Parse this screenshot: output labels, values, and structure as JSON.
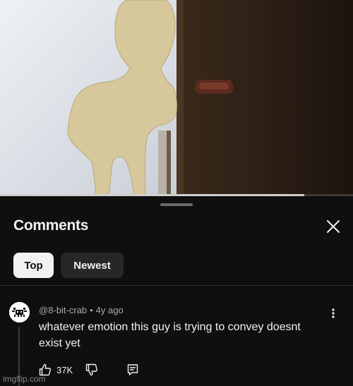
{
  "video": {
    "progress_fraction": 0.862
  },
  "comments_panel": {
    "title": "Comments",
    "close_icon": "close-icon",
    "filters": [
      {
        "label": "Top",
        "selected": true
      },
      {
        "label": "Newest",
        "selected": false
      }
    ]
  },
  "comment": {
    "author": "@8-bit-crab",
    "separator": "•",
    "age": "4y ago",
    "text": "whatever emotion this guy is trying to convey doesnt exist yet",
    "like_count": "37K",
    "icons": {
      "more": "more-vert-icon",
      "like": "thumbs-up-icon",
      "dislike": "thumbs-down-icon",
      "reply": "reply-icon"
    }
  },
  "watermark": "imgflip.com",
  "colors": {
    "sheet_background": "#0f0f0f",
    "chip_selected": "#f1f1f1",
    "chip_unselected": "#272727",
    "secondary_text": "#aaaaaa",
    "primary_text": "#f1f1f1"
  }
}
